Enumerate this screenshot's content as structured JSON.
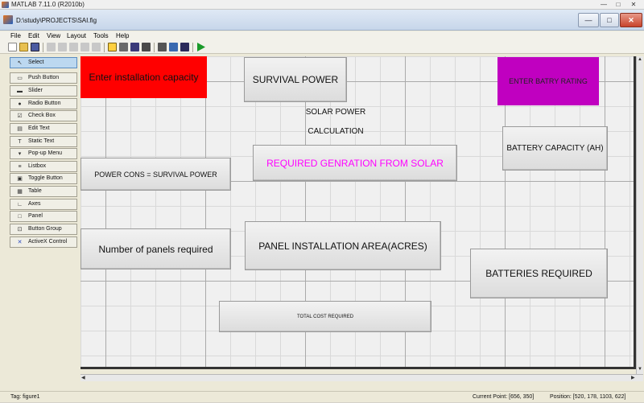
{
  "app": {
    "title": "MATLAB  7.11.0 (R2010b)",
    "controls": {
      "minimize": "—",
      "maximize": "□",
      "close": "✕"
    }
  },
  "guide": {
    "title": "D:\\study\\PROJECTS\\SAI.fig",
    "controls": {
      "minimize": "—",
      "maximize": "□",
      "close": "✕"
    }
  },
  "menu": [
    "File",
    "Edit",
    "View",
    "Layout",
    "Tools",
    "Help"
  ],
  "toolbar": {
    "icons": [
      "new-icon",
      "open-icon",
      "save-icon",
      "cut-icon",
      "copy-icon",
      "paste-icon",
      "undo-icon",
      "redo-icon",
      "align-icon",
      "menu-editor-icon",
      "tab-order-icon",
      "toolbar-editor-icon",
      "mfile-editor-icon",
      "property-inspector-icon",
      "object-browser-icon",
      "run-icon"
    ]
  },
  "palette": {
    "items": [
      {
        "label": "Select",
        "icon": "arrow-cursor-icon",
        "glyph": "↖",
        "selected": true
      },
      {
        "label": "Push Button",
        "icon": "push-button-icon",
        "glyph": "▭",
        "selected": false
      },
      {
        "label": "Slider",
        "icon": "slider-icon",
        "glyph": "▬",
        "selected": false
      },
      {
        "label": "Radio Button",
        "icon": "radio-button-icon",
        "glyph": "●",
        "selected": false
      },
      {
        "label": "Check Box",
        "icon": "check-box-icon",
        "glyph": "☑",
        "selected": false
      },
      {
        "label": "Edit Text",
        "icon": "edit-text-icon",
        "glyph": "▤",
        "selected": false
      },
      {
        "label": "Static Text",
        "icon": "static-text-icon",
        "glyph": "T",
        "selected": false
      },
      {
        "label": "Pop-up Menu",
        "icon": "popup-menu-icon",
        "glyph": "▾",
        "selected": false
      },
      {
        "label": "Listbox",
        "icon": "listbox-icon",
        "glyph": "≡",
        "selected": false
      },
      {
        "label": "Toggle Button",
        "icon": "toggle-button-icon",
        "glyph": "▣",
        "selected": false
      },
      {
        "label": "Table",
        "icon": "table-icon",
        "glyph": "▦",
        "selected": false
      },
      {
        "label": "Axes",
        "icon": "axes-icon",
        "glyph": "∟",
        "selected": false
      },
      {
        "label": "Panel",
        "icon": "panel-icon",
        "glyph": "□",
        "selected": false
      },
      {
        "label": "Button Group",
        "icon": "button-group-icon",
        "glyph": "⊡",
        "selected": false
      },
      {
        "label": "ActiveX Control",
        "icon": "activex-icon",
        "glyph": "✕",
        "selected": false
      }
    ]
  },
  "canvas": {
    "components": {
      "install_capacity": "Enter installation capacity",
      "survival_power": "SURVIVAL POWER",
      "battery_rating": "ENTER BATRY RATING",
      "solar_line1": "SOLAR POWER",
      "solar_line2": "CALCULATION",
      "battery_capacity": "BATTERY CAPACITY (AH)",
      "power_cons": "POWER CONS = SURVIVAL POWER",
      "required_generation": "REQUIRED GENRATION FROM SOLAR",
      "panels_required": "Number of panels required",
      "panel_area": "PANEL INSTALLATION AREA(ACRES)",
      "batteries_required": "BATTERIES REQUIRED",
      "total_cost": "TOTAL COST REQUIRED"
    },
    "colors": {
      "red": "#ff0000",
      "purple": "#c000c0",
      "magenta": "#ff00ff"
    }
  },
  "status": {
    "tag": "Tag: figure1",
    "current_point": "Current Point:  [656, 350]",
    "position": "Position: [520, 178, 1103, 622]"
  }
}
